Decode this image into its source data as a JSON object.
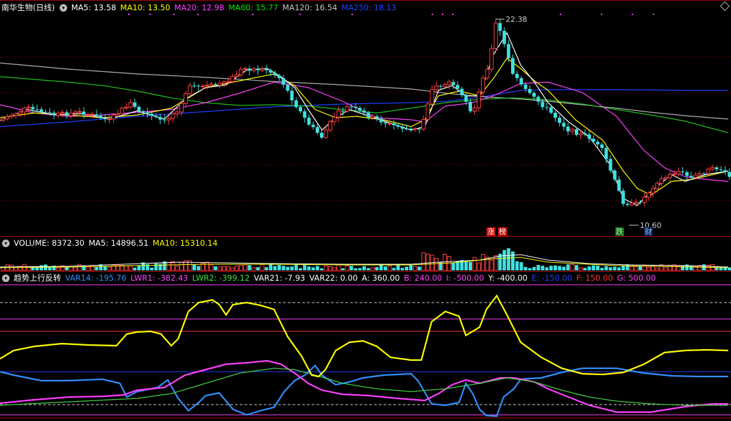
{
  "main_panel": {
    "title": "南华生物(日线)",
    "ma": [
      {
        "label": "MA5: 13.58",
        "color": "#ffffff"
      },
      {
        "label": "MA10: 13.50",
        "color": "#ffff00"
      },
      {
        "label": "MA20: 12.98",
        "color": "#ff40ff"
      },
      {
        "label": "MA60: 15.77",
        "color": "#00e000"
      },
      {
        "label": "MA120: 16.54",
        "color": "#c8c8c8"
      },
      {
        "label": "MA250: 18.13",
        "color": "#2040ff"
      }
    ],
    "high_label": "22.38",
    "low_label": "10.60",
    "tags": {
      "zhang": "涨",
      "bang": "榜",
      "die": "跌",
      "cai": "财"
    }
  },
  "volume_panel": {
    "items": [
      {
        "label": "VOLUME: 8372.30",
        "color": "#ffffff"
      },
      {
        "label": "MA5: 14896.51",
        "color": "#ffffff"
      },
      {
        "label": "MA10: 15310.14",
        "color": "#ffff00"
      }
    ]
  },
  "indicator_panel": {
    "title": "趋势上行反转",
    "items": [
      {
        "label": "VAR14: -195.76",
        "color": "#3090ff"
      },
      {
        "label": "LWR1: -382.43",
        "color": "#ff40ff"
      },
      {
        "label": "LWR2: -399.12",
        "color": "#40e040"
      },
      {
        "label": "VAR21: -7.93",
        "color": "#ffffff"
      },
      {
        "label": "VAR22: 0.00",
        "color": "#ffffff"
      },
      {
        "label": "A: 360.00",
        "color": "#ffffff"
      },
      {
        "label": "B: 240.00",
        "color": "#ff40ff"
      },
      {
        "label": "I: -500.00",
        "color": "#ff40ff"
      },
      {
        "label": "Y: -400.00",
        "color": "#ffffff"
      },
      {
        "label": "E: -150.00",
        "color": "#2040ff"
      },
      {
        "label": "F: 150.00",
        "color": "#ff3030"
      },
      {
        "label": "G: 500.00",
        "color": "#ff40ff"
      }
    ]
  }
}
